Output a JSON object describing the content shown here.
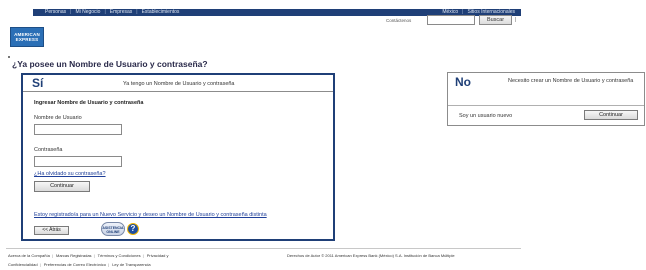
{
  "header": {
    "nav_left": [
      "Personas",
      "Mi Negocio",
      "Empresas",
      "Establecimientos"
    ],
    "nav_right": [
      "México",
      "Sitios Internacionales"
    ],
    "logo_text": "AMERICAN EXPRESS",
    "search": {
      "label": "Contáctenos",
      "value": "",
      "button_label": "Buscar",
      "tail": "|"
    }
  },
  "main": {
    "title": "¿Ya posee un Nombre de Usuario y contraseña?"
  },
  "si_panel": {
    "heading": "Sí",
    "description": "Ya tengo un Nombre de Usuario y contraseña",
    "subheading": "Ingresar Nombre de Usuario y contraseña",
    "username_label": "Nombre de Usuario",
    "username_value": "",
    "password_label": "Contraseña",
    "password_value": "",
    "forgot_link": "¿Ha olvidado su contraseña?",
    "continue_label": "Continuar",
    "new_service_link": "Estoy registrado/a para un Nuevo Servicio y deseo un Nombre de Usuario y contraseña distinta",
    "back_label": "<< Atrás",
    "help_badge": "ASISTENCIA ONLINE",
    "help_icon": "?"
  },
  "no_panel": {
    "heading": "No",
    "description": "Necesito crear un Nombre de Usuario y contraseña",
    "new_user_label": "Soy un usuario nuevo",
    "continue_label": "Continuar"
  },
  "footer": {
    "links_row1": [
      "Acerca de la Compañía",
      "Marcas Registradas",
      "Términos y Condiciones",
      "Privacidad y"
    ],
    "links_row2": [
      "Confidencialidad",
      "Preferencias de Correo Electrónico",
      "Ley de Transparencia"
    ],
    "copyright": "Derechos de Autor © 2011 American Express Bank (México) S.A. Institución de Banca Múltiple"
  },
  "colors": {
    "brand_navy": "#1f3f77",
    "link_blue": "#1f3f99",
    "logo_blue": "#2b6fb6"
  }
}
